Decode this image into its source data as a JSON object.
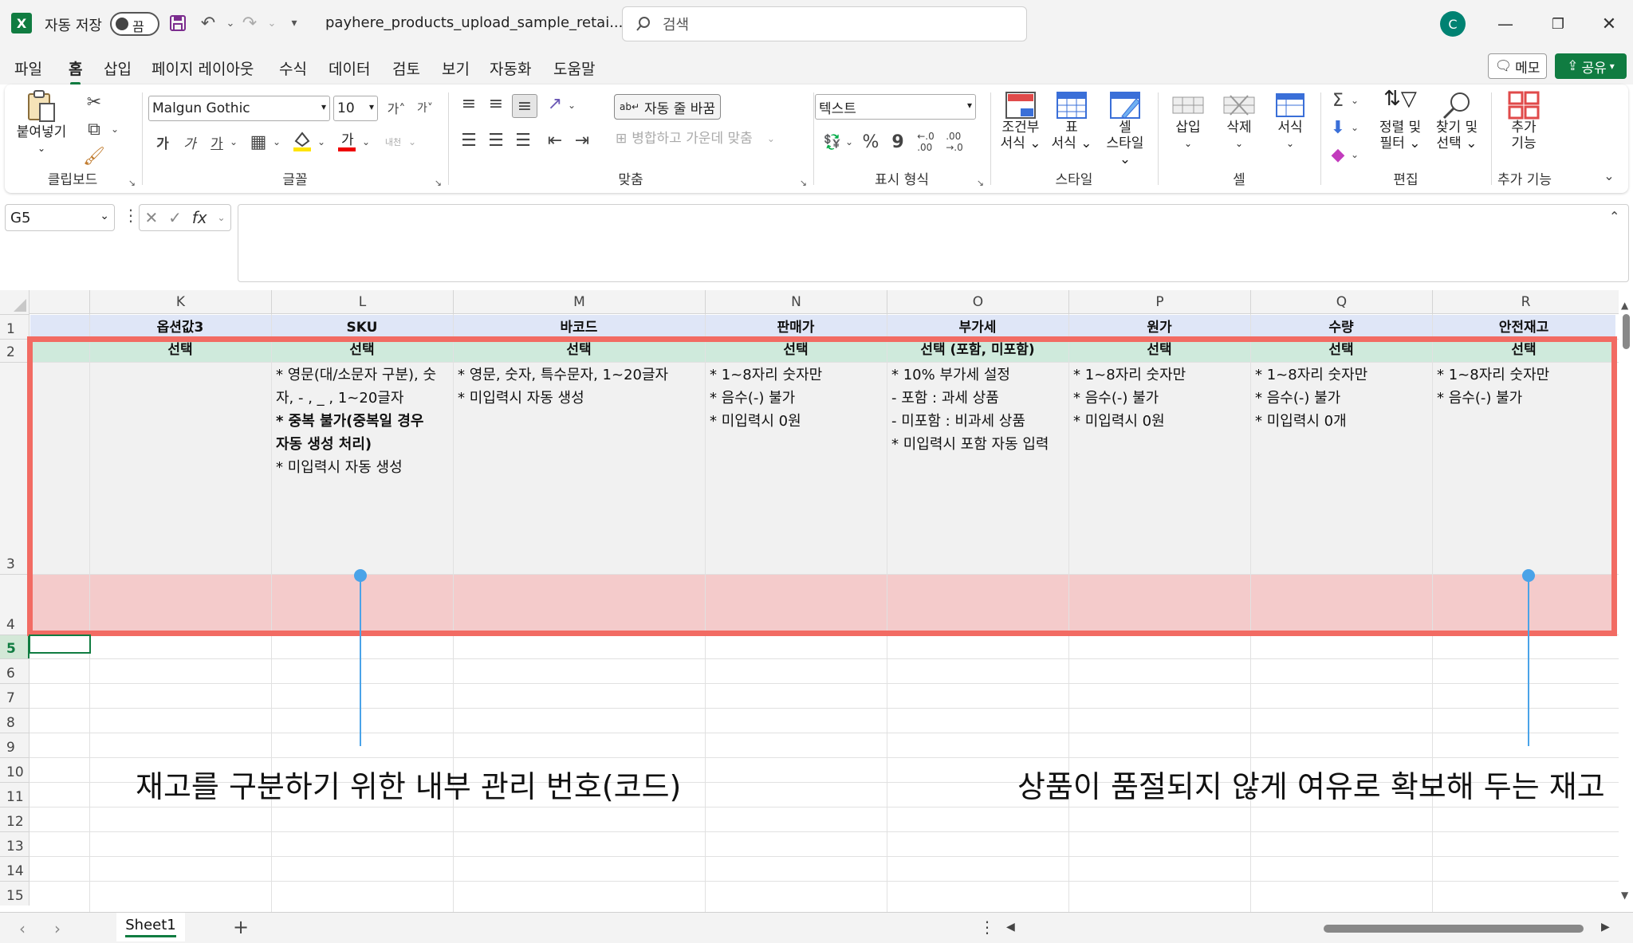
{
  "titlebar": {
    "app_icon": "X",
    "autosave_label": "자동 저장",
    "autosave_state": "끔",
    "filename": "payhere_products_upload_sample_retai...",
    "search_placeholder": "검색",
    "avatar_initial": "C"
  },
  "menu": {
    "items": [
      "파일",
      "홈",
      "삽입",
      "페이지 레이아웃",
      "수식",
      "데이터",
      "검토",
      "보기",
      "자동화",
      "도움말"
    ],
    "active": "홈",
    "memo_label": "메모",
    "share_label": "공유"
  },
  "ribbon": {
    "clipboard": {
      "paste_label": "붙여넣기",
      "group_label": "클립보드"
    },
    "font": {
      "font_name": "Malgun Gothic",
      "font_size": "10",
      "bold": "가",
      "italic": "가",
      "underline": "가",
      "phonetic": "내천",
      "group_label": "글꼴"
    },
    "alignment": {
      "wrap_label": "자동 줄 바꿈",
      "merge_label": "병합하고 가운데 맞춤",
      "group_label": "맞춤"
    },
    "number": {
      "format": "텍스트",
      "percent": "%",
      "comma": "9",
      "group_label": "표시 형식"
    },
    "styles": {
      "conditional_label1": "조건부",
      "conditional_label2": "서식",
      "table_label1": "표",
      "table_label2": "서식",
      "cell_style_label1": "셀",
      "cell_style_label2": "스타일",
      "group_label": "스타일"
    },
    "cells": {
      "insert_label": "삽입",
      "delete_label": "삭제",
      "format_label": "서식",
      "group_label": "셀"
    },
    "editing": {
      "sort_label1": "정렬 및",
      "sort_label2": "필터",
      "find_label1": "찾기 및",
      "find_label2": "선택",
      "group_label": "편집"
    },
    "addins": {
      "label1": "추가",
      "label2": "기능",
      "group_label": "추가 기능"
    }
  },
  "formula_bar": {
    "name_box": "G5",
    "fx": "fx",
    "value": ""
  },
  "sheet": {
    "columns": [
      "K",
      "L",
      "M",
      "N",
      "O",
      "P",
      "Q",
      "R"
    ],
    "rows": [
      "1",
      "2",
      "3",
      "4",
      "5",
      "6",
      "7",
      "8",
      "9",
      "10",
      "11",
      "12",
      "13",
      "14",
      "15"
    ],
    "row1": [
      "옵션값3",
      "SKU",
      "바코드",
      "판매가",
      "부가세",
      "원가",
      "수량",
      "안전재고"
    ],
    "row2": [
      "선택",
      "선택",
      "선택",
      "선택",
      "선택 (포함, 미포함)",
      "선택",
      "선택",
      "선택"
    ],
    "row3": {
      "K": [],
      "L": [
        {
          "t": "* 영문(대/소문자 구분), 숫",
          "b": false
        },
        {
          "t": "자, - , _ , 1~20글자",
          "b": false
        },
        {
          "t": "* 중복 불가(중복일 경우",
          "b": true
        },
        {
          "t": "자동 생성 처리)",
          "b": true
        },
        {
          "t": "* 미입력시 자동 생성",
          "b": false
        }
      ],
      "M": [
        {
          "t": "* 영문, 숫자, 특수문자, 1~20글자",
          "b": false
        },
        {
          "t": "* 미입력시 자동 생성",
          "b": false
        }
      ],
      "N": [
        {
          "t": "* 1~8자리 숫자만",
          "b": false
        },
        {
          "t": "* 음수(-) 불가",
          "b": false
        },
        {
          "t": "* 미입력시 0원",
          "b": false
        }
      ],
      "O": [
        {
          "t": "* 10% 부가세 설정",
          "b": false
        },
        {
          "t": "- 포함 : 과세 상품",
          "b": false
        },
        {
          "t": "- 미포함 : 비과세 상품",
          "b": false
        },
        {
          "t": "* 미입력시 포함 자동 입력",
          "b": false
        }
      ],
      "P": [
        {
          "t": "* 1~8자리 숫자만",
          "b": false
        },
        {
          "t": "* 음수(-) 불가",
          "b": false
        },
        {
          "t": "* 미입력시 0원",
          "b": false
        }
      ],
      "Q": [
        {
          "t": "* 1~8자리 숫자만",
          "b": false
        },
        {
          "t": "* 음수(-) 불가",
          "b": false
        },
        {
          "t": "* 미입력시 0개",
          "b": false
        }
      ],
      "R": [
        {
          "t": "* 1~8자리 숫자만",
          "b": false
        },
        {
          "t": "* 음수(-) 불가",
          "b": false
        }
      ]
    },
    "annotations": {
      "sku": "재고를 구분하기 위한 내부 관리 번호(코드)",
      "safety_stock": "상품이 품절되지 않게 여유로 확보해 두는 재고"
    },
    "colors": {
      "row1": "#dfe6f7",
      "row2": "#cfeadc",
      "highlight": "#f4cbcb",
      "outline": "#f26b63",
      "callout": "#4aa3e8"
    }
  },
  "tabs": {
    "sheet_name": "Sheet1",
    "add": "+"
  }
}
